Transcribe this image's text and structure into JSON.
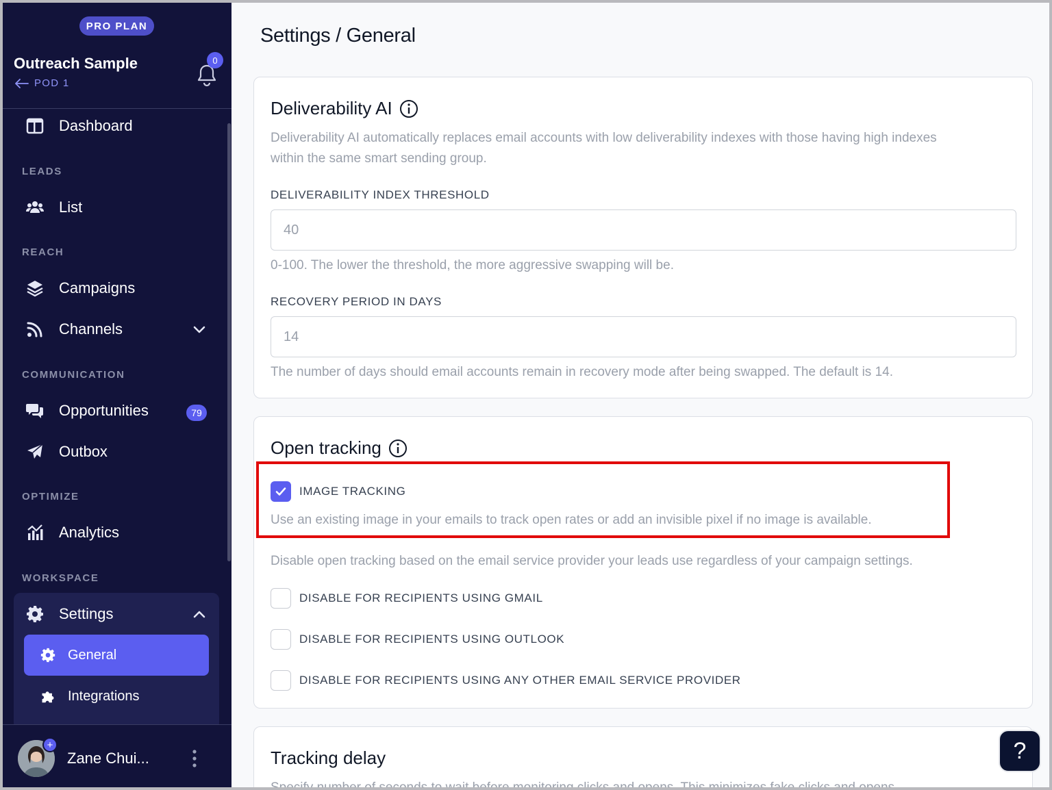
{
  "sidebar": {
    "plan_badge": "PRO PLAN",
    "workspace_name": "Outreach Sample",
    "pod": "POD 1",
    "notification_count": "0",
    "sections": {
      "leads": "LEADS",
      "reach": "REACH",
      "communication": "COMMUNICATION",
      "optimize": "OPTIMIZE",
      "workspace": "WORKSPACE"
    },
    "items": {
      "dashboard": "Dashboard",
      "list": "List",
      "campaigns": "Campaigns",
      "channels": "Channels",
      "opportunities": "Opportunities",
      "opportunities_count": "79",
      "outbox": "Outbox",
      "analytics": "Analytics",
      "settings": "Settings",
      "general": "General",
      "integrations": "Integrations"
    },
    "user_name": "Zane Chui..."
  },
  "page": {
    "title": "Settings / General"
  },
  "deliverability": {
    "title": "Deliverability AI",
    "description_line1": "Deliverability AI automatically replaces email accounts with low deliverability indexes with those having high indexes",
    "description_line2": "within the same smart sending group.",
    "threshold_label": "DELIVERABILITY INDEX THRESHOLD",
    "threshold_value": "40",
    "threshold_help": "0-100. The lower the threshold, the more aggressive swapping will be.",
    "recovery_label": "RECOVERY PERIOD IN DAYS",
    "recovery_value": "14",
    "recovery_help": "The number of days should email accounts remain in recovery mode after being swapped. The default is 14."
  },
  "open_tracking": {
    "title": "Open tracking",
    "image_tracking_label": "IMAGE TRACKING",
    "image_tracking_checked": true,
    "image_tracking_help": "Use an existing image in your emails to track open rates or add an invisible pixel if no image is available.",
    "disable_intro": "Disable open tracking based on the email service provider your leads use regardless of your campaign settings.",
    "disable_gmail": "DISABLE FOR RECIPIENTS USING GMAIL",
    "disable_outlook": "DISABLE FOR RECIPIENTS USING OUTLOOK",
    "disable_other": "DISABLE FOR RECIPIENTS USING ANY OTHER EMAIL SERVICE PROVIDER"
  },
  "tracking_delay": {
    "title": "Tracking delay",
    "description": "Specify number of seconds to wait before monitoring clicks and opens. This minimizes fake clicks and opens."
  },
  "help_button": "?",
  "colors": {
    "sidebar_bg": "#12133a",
    "accent": "#5b5ef0",
    "highlight": "#e10b0b"
  }
}
